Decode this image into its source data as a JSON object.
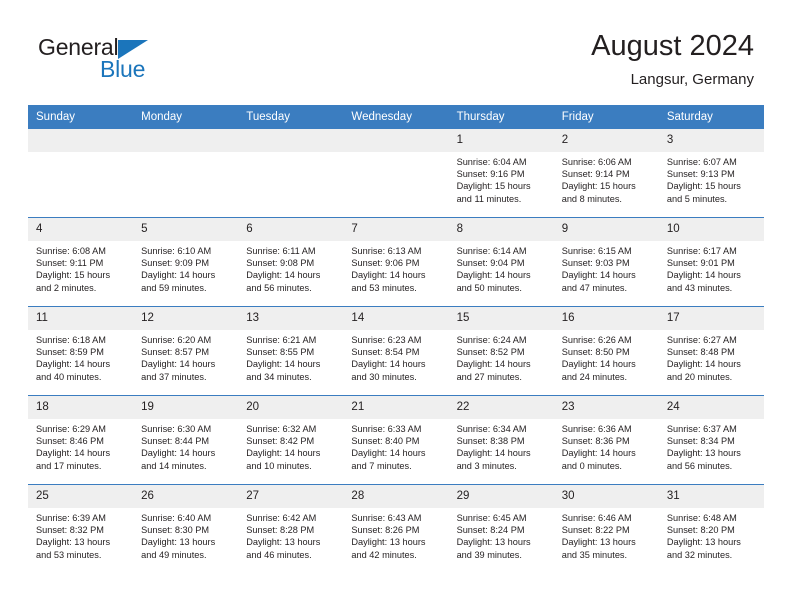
{
  "brand": {
    "name_part1": "General",
    "name_part2": "Blue",
    "logo_icon": "triangle-logo-icon",
    "accent_color": "#1b75bb"
  },
  "header": {
    "title": "August 2024",
    "subtitle": "Langsur, Germany"
  },
  "theme": {
    "header_row_color": "#3b7dc0",
    "daynum_band_color": "#efefef",
    "text_color": "#231f20"
  },
  "weekdays": [
    "Sunday",
    "Monday",
    "Tuesday",
    "Wednesday",
    "Thursday",
    "Friday",
    "Saturday"
  ],
  "weeks": [
    [
      {
        "day": "",
        "sunrise": "",
        "sunset": "",
        "daylight_line1": "",
        "daylight_line2": ""
      },
      {
        "day": "",
        "sunrise": "",
        "sunset": "",
        "daylight_line1": "",
        "daylight_line2": ""
      },
      {
        "day": "",
        "sunrise": "",
        "sunset": "",
        "daylight_line1": "",
        "daylight_line2": ""
      },
      {
        "day": "",
        "sunrise": "",
        "sunset": "",
        "daylight_line1": "",
        "daylight_line2": ""
      },
      {
        "day": "1",
        "sunrise": "Sunrise: 6:04 AM",
        "sunset": "Sunset: 9:16 PM",
        "daylight_line1": "Daylight: 15 hours",
        "daylight_line2": "and 11 minutes."
      },
      {
        "day": "2",
        "sunrise": "Sunrise: 6:06 AM",
        "sunset": "Sunset: 9:14 PM",
        "daylight_line1": "Daylight: 15 hours",
        "daylight_line2": "and 8 minutes."
      },
      {
        "day": "3",
        "sunrise": "Sunrise: 6:07 AM",
        "sunset": "Sunset: 9:13 PM",
        "daylight_line1": "Daylight: 15 hours",
        "daylight_line2": "and 5 minutes."
      }
    ],
    [
      {
        "day": "4",
        "sunrise": "Sunrise: 6:08 AM",
        "sunset": "Sunset: 9:11 PM",
        "daylight_line1": "Daylight: 15 hours",
        "daylight_line2": "and 2 minutes."
      },
      {
        "day": "5",
        "sunrise": "Sunrise: 6:10 AM",
        "sunset": "Sunset: 9:09 PM",
        "daylight_line1": "Daylight: 14 hours",
        "daylight_line2": "and 59 minutes."
      },
      {
        "day": "6",
        "sunrise": "Sunrise: 6:11 AM",
        "sunset": "Sunset: 9:08 PM",
        "daylight_line1": "Daylight: 14 hours",
        "daylight_line2": "and 56 minutes."
      },
      {
        "day": "7",
        "sunrise": "Sunrise: 6:13 AM",
        "sunset": "Sunset: 9:06 PM",
        "daylight_line1": "Daylight: 14 hours",
        "daylight_line2": "and 53 minutes."
      },
      {
        "day": "8",
        "sunrise": "Sunrise: 6:14 AM",
        "sunset": "Sunset: 9:04 PM",
        "daylight_line1": "Daylight: 14 hours",
        "daylight_line2": "and 50 minutes."
      },
      {
        "day": "9",
        "sunrise": "Sunrise: 6:15 AM",
        "sunset": "Sunset: 9:03 PM",
        "daylight_line1": "Daylight: 14 hours",
        "daylight_line2": "and 47 minutes."
      },
      {
        "day": "10",
        "sunrise": "Sunrise: 6:17 AM",
        "sunset": "Sunset: 9:01 PM",
        "daylight_line1": "Daylight: 14 hours",
        "daylight_line2": "and 43 minutes."
      }
    ],
    [
      {
        "day": "11",
        "sunrise": "Sunrise: 6:18 AM",
        "sunset": "Sunset: 8:59 PM",
        "daylight_line1": "Daylight: 14 hours",
        "daylight_line2": "and 40 minutes."
      },
      {
        "day": "12",
        "sunrise": "Sunrise: 6:20 AM",
        "sunset": "Sunset: 8:57 PM",
        "daylight_line1": "Daylight: 14 hours",
        "daylight_line2": "and 37 minutes."
      },
      {
        "day": "13",
        "sunrise": "Sunrise: 6:21 AM",
        "sunset": "Sunset: 8:55 PM",
        "daylight_line1": "Daylight: 14 hours",
        "daylight_line2": "and 34 minutes."
      },
      {
        "day": "14",
        "sunrise": "Sunrise: 6:23 AM",
        "sunset": "Sunset: 8:54 PM",
        "daylight_line1": "Daylight: 14 hours",
        "daylight_line2": "and 30 minutes."
      },
      {
        "day": "15",
        "sunrise": "Sunrise: 6:24 AM",
        "sunset": "Sunset: 8:52 PM",
        "daylight_line1": "Daylight: 14 hours",
        "daylight_line2": "and 27 minutes."
      },
      {
        "day": "16",
        "sunrise": "Sunrise: 6:26 AM",
        "sunset": "Sunset: 8:50 PM",
        "daylight_line1": "Daylight: 14 hours",
        "daylight_line2": "and 24 minutes."
      },
      {
        "day": "17",
        "sunrise": "Sunrise: 6:27 AM",
        "sunset": "Sunset: 8:48 PM",
        "daylight_line1": "Daylight: 14 hours",
        "daylight_line2": "and 20 minutes."
      }
    ],
    [
      {
        "day": "18",
        "sunrise": "Sunrise: 6:29 AM",
        "sunset": "Sunset: 8:46 PM",
        "daylight_line1": "Daylight: 14 hours",
        "daylight_line2": "and 17 minutes."
      },
      {
        "day": "19",
        "sunrise": "Sunrise: 6:30 AM",
        "sunset": "Sunset: 8:44 PM",
        "daylight_line1": "Daylight: 14 hours",
        "daylight_line2": "and 14 minutes."
      },
      {
        "day": "20",
        "sunrise": "Sunrise: 6:32 AM",
        "sunset": "Sunset: 8:42 PM",
        "daylight_line1": "Daylight: 14 hours",
        "daylight_line2": "and 10 minutes."
      },
      {
        "day": "21",
        "sunrise": "Sunrise: 6:33 AM",
        "sunset": "Sunset: 8:40 PM",
        "daylight_line1": "Daylight: 14 hours",
        "daylight_line2": "and 7 minutes."
      },
      {
        "day": "22",
        "sunrise": "Sunrise: 6:34 AM",
        "sunset": "Sunset: 8:38 PM",
        "daylight_line1": "Daylight: 14 hours",
        "daylight_line2": "and 3 minutes."
      },
      {
        "day": "23",
        "sunrise": "Sunrise: 6:36 AM",
        "sunset": "Sunset: 8:36 PM",
        "daylight_line1": "Daylight: 14 hours",
        "daylight_line2": "and 0 minutes."
      },
      {
        "day": "24",
        "sunrise": "Sunrise: 6:37 AM",
        "sunset": "Sunset: 8:34 PM",
        "daylight_line1": "Daylight: 13 hours",
        "daylight_line2": "and 56 minutes."
      }
    ],
    [
      {
        "day": "25",
        "sunrise": "Sunrise: 6:39 AM",
        "sunset": "Sunset: 8:32 PM",
        "daylight_line1": "Daylight: 13 hours",
        "daylight_line2": "and 53 minutes."
      },
      {
        "day": "26",
        "sunrise": "Sunrise: 6:40 AM",
        "sunset": "Sunset: 8:30 PM",
        "daylight_line1": "Daylight: 13 hours",
        "daylight_line2": "and 49 minutes."
      },
      {
        "day": "27",
        "sunrise": "Sunrise: 6:42 AM",
        "sunset": "Sunset: 8:28 PM",
        "daylight_line1": "Daylight: 13 hours",
        "daylight_line2": "and 46 minutes."
      },
      {
        "day": "28",
        "sunrise": "Sunrise: 6:43 AM",
        "sunset": "Sunset: 8:26 PM",
        "daylight_line1": "Daylight: 13 hours",
        "daylight_line2": "and 42 minutes."
      },
      {
        "day": "29",
        "sunrise": "Sunrise: 6:45 AM",
        "sunset": "Sunset: 8:24 PM",
        "daylight_line1": "Daylight: 13 hours",
        "daylight_line2": "and 39 minutes."
      },
      {
        "day": "30",
        "sunrise": "Sunrise: 6:46 AM",
        "sunset": "Sunset: 8:22 PM",
        "daylight_line1": "Daylight: 13 hours",
        "daylight_line2": "and 35 minutes."
      },
      {
        "day": "31",
        "sunrise": "Sunrise: 6:48 AM",
        "sunset": "Sunset: 8:20 PM",
        "daylight_line1": "Daylight: 13 hours",
        "daylight_line2": "and 32 minutes."
      }
    ]
  ]
}
